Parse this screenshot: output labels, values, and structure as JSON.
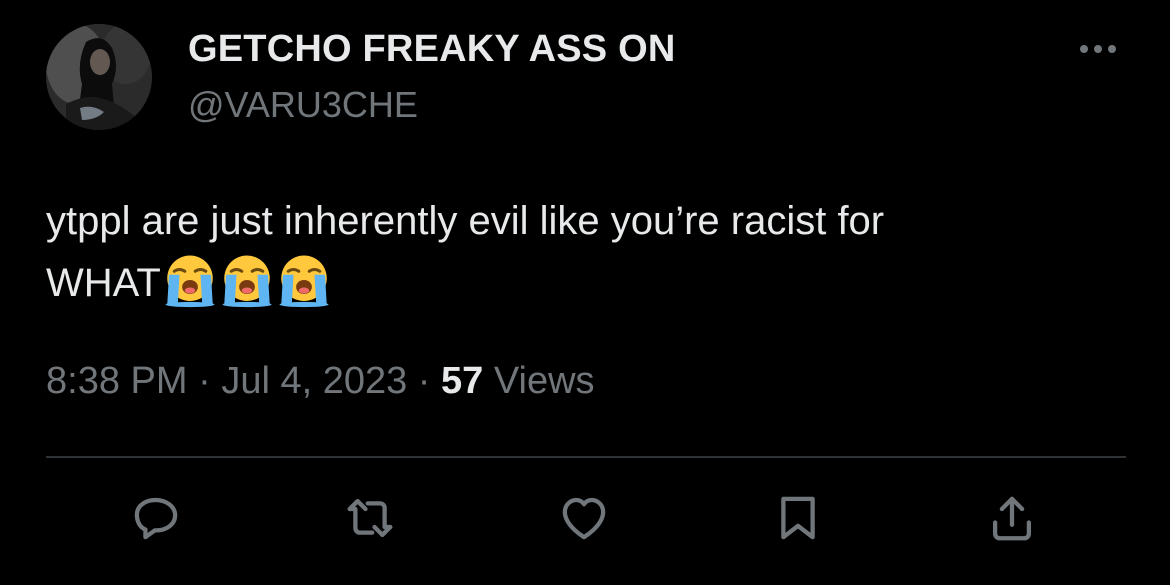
{
  "tweet": {
    "display_name": "GETCHO FREAKY ASS ON",
    "handle": "@VARU3CHE",
    "text_line1": "ytppl are just inherently evil like you’re racist for",
    "text_line2": "WHAT",
    "emojis": [
      "loudly-crying-face",
      "loudly-crying-face",
      "loudly-crying-face"
    ],
    "time": "8:38 PM",
    "separator": " · ",
    "date": "Jul 4, 2023",
    "views_count": "57",
    "views_label": " Views"
  },
  "actions": {
    "reply": "reply-icon",
    "retweet": "retweet-icon",
    "like": "like-heart-icon",
    "bookmark": "bookmark-icon",
    "share": "share-icon"
  },
  "colors": {
    "background": "#000000",
    "primary_text": "#e7e9ea",
    "secondary_text": "#71767b",
    "divider": "#2f3336",
    "emoji_face": "#ffc83d",
    "emoji_tears": "#5fb4f2"
  }
}
